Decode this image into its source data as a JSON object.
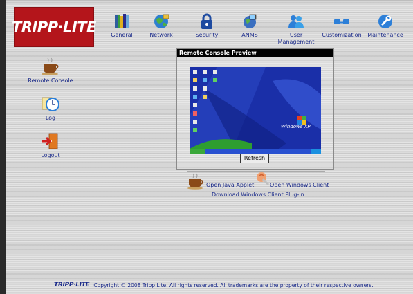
{
  "brand": {
    "logo_text": "TRIPP·LITE",
    "footer_logo": "TRIPP·LITE"
  },
  "nav": {
    "items": [
      {
        "label": "General",
        "icon": "books-icon"
      },
      {
        "label": "Network",
        "icon": "network-globe-icon"
      },
      {
        "label": "Security",
        "icon": "padlock-icon"
      },
      {
        "label": "ANMS",
        "icon": "anms-globe-icon"
      },
      {
        "label": "User Management",
        "icon": "users-icon"
      },
      {
        "label": "Customization",
        "icon": "connector-icon"
      },
      {
        "label": "Maintenance",
        "icon": "tools-icon"
      }
    ]
  },
  "sidebar": {
    "items": [
      {
        "label": "Remote Console",
        "icon": "coffee-cup-icon"
      },
      {
        "label": "Log",
        "icon": "clock-icon"
      },
      {
        "label": "Logout",
        "icon": "exit-door-icon"
      }
    ]
  },
  "preview": {
    "title": "Remote Console Preview",
    "screen_text": "Windows XP",
    "refresh_label": "Refresh"
  },
  "clients": {
    "java_label": "Open Java Applet",
    "windows_label": "Open Windows Client",
    "plugin_label": "Download Windows Client Plug-in"
  },
  "footer": {
    "copyright": "Copyright © 2008 Tripp Lite. All rights reserved. All trademarks are the property of their respective owners."
  },
  "colors": {
    "brand_red": "#b4151b",
    "link_blue": "#1a2a8a",
    "desktop_blue": "#1a2fa8"
  }
}
